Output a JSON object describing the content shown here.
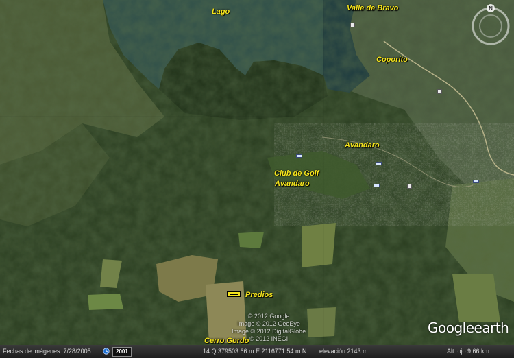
{
  "map": {
    "labels": {
      "lago": "Lago",
      "valle_de_bravo": "Valle de Bravo",
      "coporito": "Coporito",
      "avandaro": "Avandaro",
      "club_golf_line1": "Club de Golf",
      "club_golf_line2": "Avandaro",
      "predios": "Predios",
      "cerro_gordo": "Cerro Gordo"
    },
    "label_color": "#f5e51c",
    "water_color": "#2f4f4a",
    "forest_color": "#24361c",
    "compass_letter": "N"
  },
  "overlay": {
    "copyright": [
      "© 2012 Google",
      "Image © 2012 GeoEye",
      "Image © 2012 DigitalGlobe",
      "© 2012 INEGI"
    ],
    "logo_google": "Google",
    "logo_earth": "earth"
  },
  "statusbar": {
    "imagery_dates": "Fechas de imágenes: 7/28/2005",
    "year": "2001",
    "coordinates": "14 Q 379503.66 m E 2116771.54 m N",
    "elevation": "elevación  2143 m",
    "eye_alt": "Alt. ojo   9.66 km"
  }
}
